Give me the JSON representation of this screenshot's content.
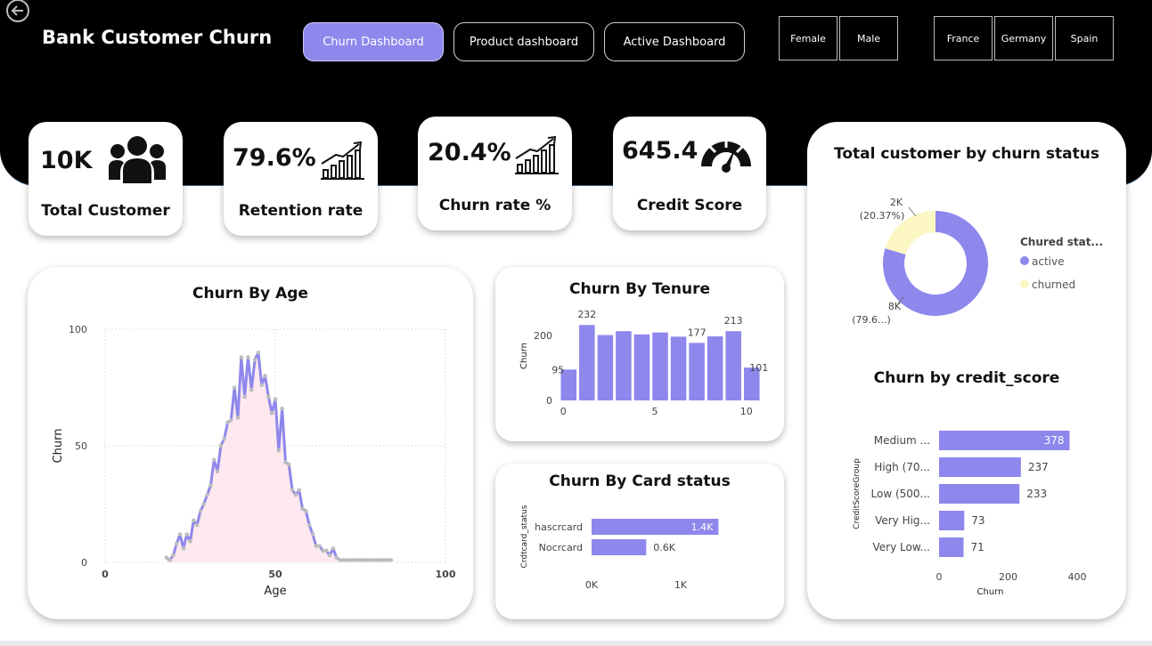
{
  "header": {
    "title": "Bank Customer Churn",
    "nav": [
      {
        "label": "Churn Dashboard",
        "active": true
      },
      {
        "label": "Product dashboard",
        "active": false
      },
      {
        "label": "Active Dashboard",
        "active": false
      }
    ],
    "gender_slicer": [
      "Female",
      "Male"
    ],
    "country_slicer": [
      "France",
      "Germany",
      "Spain"
    ]
  },
  "kpis": [
    {
      "value": "10K",
      "label": "Total Customer",
      "icon": "people-icon"
    },
    {
      "value": "79.6%",
      "label": "Retention rate",
      "icon": "growth-chart-icon"
    },
    {
      "value": "20.4%",
      "label": "Churn rate %",
      "icon": "growth-chart-icon"
    },
    {
      "value": "645.4",
      "label": "Credit Score",
      "icon": "gauge-icon"
    }
  ],
  "colors": {
    "accent": "#8e87ec",
    "churned": "#fbf6c2",
    "area_fill": "#fde9ef",
    "header_bg": "#000000"
  },
  "charts": {
    "age": {
      "title": "Churn By Age",
      "chart_data": {
        "type": "line",
        "xlabel": "Age",
        "ylabel": "Churn",
        "xlim": [
          0,
          100
        ],
        "ylim": [
          0,
          100
        ],
        "x_ticks": [
          "0",
          "50",
          "100"
        ],
        "y_ticks": [
          "0",
          "50",
          "100"
        ],
        "grid": true,
        "x": [
          18,
          19,
          20,
          21,
          22,
          23,
          24,
          25,
          26,
          27,
          28,
          29,
          30,
          31,
          32,
          33,
          34,
          35,
          36,
          37,
          38,
          39,
          40,
          41,
          42,
          43,
          44,
          45,
          46,
          47,
          48,
          49,
          50,
          51,
          52,
          53,
          54,
          55,
          56,
          57,
          58,
          59,
          60,
          61,
          62,
          63,
          64,
          65,
          66,
          67,
          68,
          69,
          70,
          71,
          72,
          73,
          74,
          75,
          76,
          77,
          78,
          79,
          80,
          81,
          82,
          83,
          84
        ],
        "y": [
          2,
          1,
          3,
          8,
          12,
          6,
          12,
          9,
          18,
          16,
          22,
          25,
          29,
          33,
          44,
          39,
          50,
          53,
          60,
          61,
          75,
          62,
          88,
          71,
          88,
          74,
          87,
          90,
          76,
          80,
          71,
          64,
          70,
          48,
          66,
          43,
          42,
          31,
          29,
          31,
          23,
          22,
          16,
          12,
          7,
          7,
          5,
          5,
          3,
          6,
          2,
          1,
          1,
          1,
          1,
          1,
          1,
          1,
          1,
          1,
          1,
          1,
          1,
          1,
          1,
          1,
          1
        ]
      }
    },
    "tenure": {
      "title": "Churn By Tenure",
      "chart_data": {
        "type": "bar",
        "ylabel": "Churn",
        "x": [
          0,
          1,
          2,
          3,
          4,
          5,
          6,
          7,
          8,
          9,
          10
        ],
        "values": [
          95,
          232,
          201,
          213,
          203,
          209,
          196,
          177,
          197,
          213,
          101
        ],
        "data_labels": [
          "95",
          "232",
          "",
          "",
          "",
          "",
          "",
          "177",
          "",
          "213",
          "101"
        ],
        "x_ticks": [
          "0",
          "5",
          "10"
        ],
        "y_ticks": [
          "0",
          "200"
        ],
        "ylim": [
          0,
          260
        ]
      }
    },
    "card": {
      "title": "Churn By Card status",
      "chart_data": {
        "type": "bar",
        "orientation": "horizontal",
        "ylabel": "Crdtcard_status",
        "categories": [
          "hascrcard",
          "Nocrcard"
        ],
        "values": [
          1424,
          613
        ],
        "data_labels": [
          "1.4K",
          "0.6K"
        ],
        "x_ticks": [
          "0K",
          "1K"
        ],
        "xlim": [
          0,
          2000
        ]
      }
    },
    "status": {
      "title": "Total customer by churn status",
      "legend_title": "Chured stat...",
      "chart_data": {
        "type": "pie",
        "donut": true,
        "categories": [
          "active",
          "churned"
        ],
        "values": [
          7963,
          2037
        ],
        "colors": [
          "#8e87ec",
          "#fbf6c2"
        ],
        "data_labels": [
          [
            "8K",
            "(79.6...)"
          ],
          [
            "2K",
            "(20.37%)"
          ]
        ],
        "legend_position": "right"
      }
    },
    "credit": {
      "title": "Churn by credit_score",
      "chart_data": {
        "type": "bar",
        "orientation": "horizontal",
        "xlabel": "Churn",
        "ylabel": "CreditScoreGroup",
        "categories": [
          "Medium ...",
          "High (70...",
          "Low (500...",
          "Very Hig...",
          "Very Low..."
        ],
        "values": [
          378,
          237,
          233,
          73,
          71
        ],
        "x_ticks": [
          "0",
          "200",
          "400"
        ],
        "xlim": [
          0,
          400
        ]
      }
    }
  }
}
